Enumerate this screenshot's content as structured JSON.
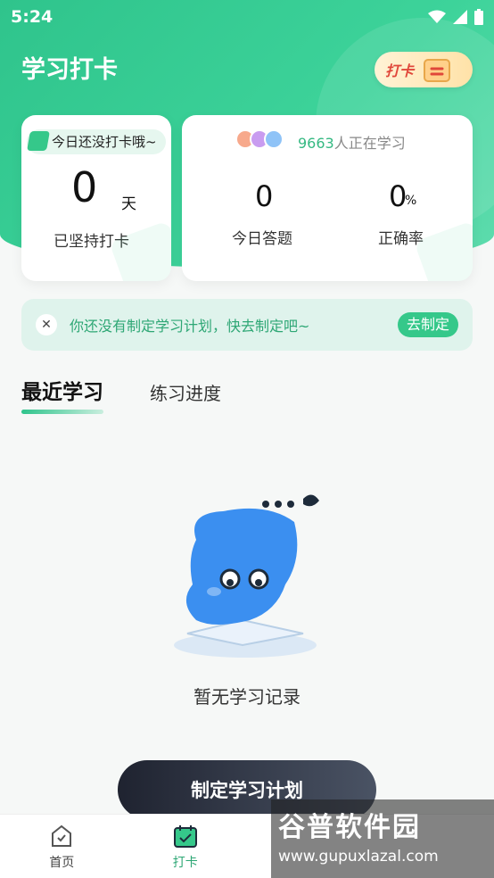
{
  "status_bar": {
    "time": "5:24"
  },
  "header": {
    "title": "学习打卡",
    "badge_label": "打卡"
  },
  "streak_card": {
    "pill_text": "今日还没打卡哦~",
    "days": "0",
    "unit": "天",
    "label": "已坚持打卡"
  },
  "stats_card": {
    "learners_count": "9663",
    "learners_suffix": "人正在学习",
    "answered": {
      "value": "0",
      "label": "今日答题"
    },
    "accuracy": {
      "value": "0",
      "unit": "%",
      "label": "正确率"
    }
  },
  "plan_banner": {
    "message": "你还没有制定学习计划，快去制定吧~",
    "action": "去制定"
  },
  "tabs": [
    {
      "label": "最近学习",
      "active": true
    },
    {
      "label": "练习进度",
      "active": false
    }
  ],
  "empty_state": {
    "text": "暂无学习记录"
  },
  "cta": {
    "label": "制定学习计划"
  },
  "bottom_nav": [
    {
      "label": "首页",
      "icon": "home-icon",
      "active": false
    },
    {
      "label": "打卡",
      "icon": "calendar-check-icon",
      "active": true
    }
  ],
  "watermark": {
    "title": "谷普软件园",
    "url": "www.gupuxlazal.com"
  },
  "colors": {
    "accent": "#35c88a",
    "header_green": "#2fc48c",
    "cta_dark": "#1f2330"
  }
}
